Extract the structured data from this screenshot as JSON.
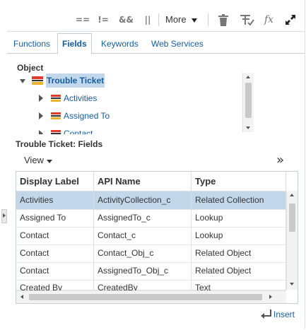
{
  "toolbar": {
    "operators": [
      {
        "name": "equals-operator",
        "label": "=="
      },
      {
        "name": "not-equals-operator",
        "label": "!="
      },
      {
        "name": "and-operator",
        "label": "&&"
      },
      {
        "name": "or-operator",
        "label": "||"
      }
    ],
    "more_label": "More",
    "icons": [
      "trash-icon",
      "validate-icon",
      "function-icon",
      "expand-icon"
    ],
    "function_glyph": "fx"
  },
  "tabs": [
    {
      "label": "Functions",
      "active": false
    },
    {
      "label": "Fields",
      "active": true
    },
    {
      "label": "Keywords",
      "active": false
    },
    {
      "label": "Web Services",
      "active": false
    }
  ],
  "object": {
    "heading": "Object",
    "root": "Trouble Ticket",
    "children": [
      "Activities",
      "Assigned To",
      "Contact"
    ]
  },
  "fields": {
    "heading": "Trouble Ticket: Fields",
    "view_label": "View",
    "overflow_glyph": "»",
    "columns": [
      "Display Label",
      "API Name",
      "Type"
    ],
    "rows": [
      {
        "label": "Activities",
        "api": "ActivityCollection_c",
        "type": "Related Collection",
        "selected": true
      },
      {
        "label": "Assigned To",
        "api": "AssignedTo_c",
        "type": "Lookup",
        "selected": false
      },
      {
        "label": "Contact",
        "api": "Contact_c",
        "type": "Lookup",
        "selected": false
      },
      {
        "label": "Contact",
        "api": "Contact_Obj_c",
        "type": "Related Object",
        "selected": false
      },
      {
        "label": "Contact",
        "api": "AssignedTo_Obj_c",
        "type": "Related Object",
        "selected": false
      },
      {
        "label": "Created By",
        "api": "CreatedBy",
        "type": "Text",
        "selected": false
      }
    ]
  },
  "insert_label": "Insert",
  "colors": {
    "link": "#145c9e",
    "selected_row": "#c2d8ea",
    "border": "#c4ced7"
  }
}
